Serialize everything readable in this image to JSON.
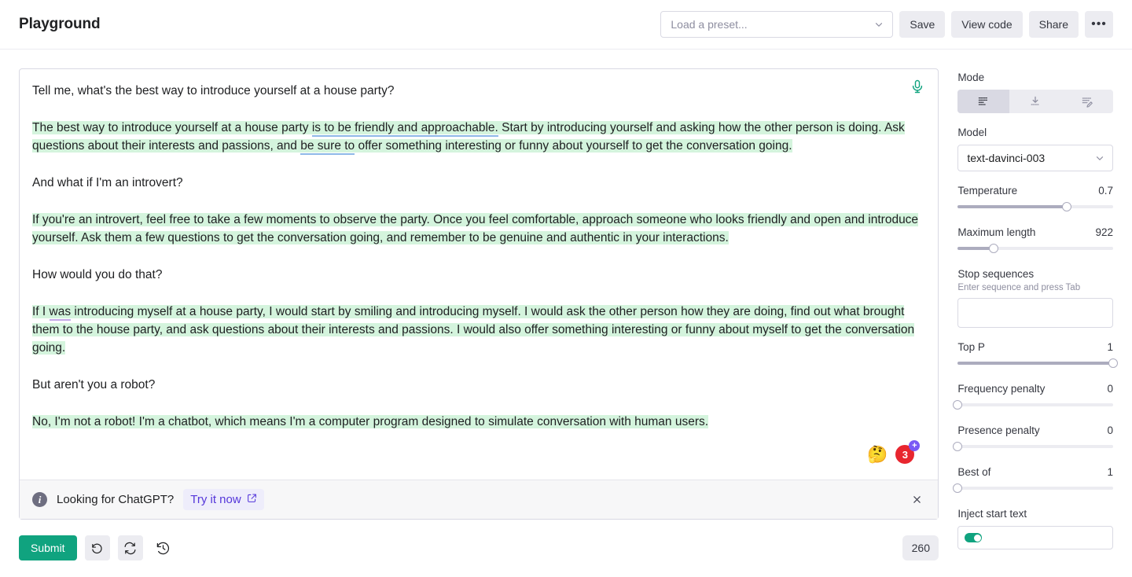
{
  "header": {
    "title": "Playground",
    "preset_placeholder": "Load a preset...",
    "save_label": "Save",
    "view_code_label": "View code",
    "share_label": "Share",
    "more_label": "•••"
  },
  "editor": {
    "mic_icon": "microphone-icon",
    "paragraphs": [
      {
        "kind": "prompt",
        "text": "Tell me, what's the best way to introduce yourself at a house party?"
      },
      {
        "kind": "completion",
        "segments": [
          {
            "text": "The best way to introduce yourself at a house party ",
            "underline": "none"
          },
          {
            "text": "is to be friendly and approachable.",
            "underline": "blue"
          },
          {
            "text": " Start by introducing yourself and asking how the other person is doing. Ask questions about their interests and passions, and ",
            "underline": "none"
          },
          {
            "text": "be sure to",
            "underline": "blue"
          },
          {
            "text": " offer something interesting or funny about yourself to get the conversation going.",
            "underline": "none"
          }
        ]
      },
      {
        "kind": "prompt",
        "text": "And what if I'm an introvert?"
      },
      {
        "kind": "completion",
        "segments": [
          {
            "text": "If you're an introvert, feel free to take a few moments to observe the party. Once you feel comfortable, approach someone who looks friendly and open and introduce yourself. Ask them a few questions to get the conversation going, and remember to be genuine and authentic in your interactions.",
            "underline": "none"
          }
        ]
      },
      {
        "kind": "prompt",
        "text": "How would you do that?"
      },
      {
        "kind": "completion",
        "segments": [
          {
            "text": "If I ",
            "underline": "none"
          },
          {
            "text": "was",
            "underline": "purple"
          },
          {
            "text": " introducing myself at a house party, I would start by smiling and introducing myself. I would ask the other person how they are doing, find out what brought them to the house party, and ask questions about their interests and passions. I would also offer something interesting or funny about myself to get the conversation going.",
            "underline": "none"
          }
        ]
      },
      {
        "kind": "prompt",
        "text": "But aren't you a robot?"
      },
      {
        "kind": "completion",
        "segments": [
          {
            "text": "No, I'm not a robot! I'm a chatbot, which means I'm a computer program designed to simulate conversation with human users.",
            "underline": "none"
          }
        ]
      }
    ],
    "badges": {
      "emoji": "🤔",
      "emoji_name": "thinking-face-emoji",
      "count": "3",
      "plus": "+"
    }
  },
  "banner": {
    "info_icon": "info-icon",
    "text": "Looking for ChatGPT?",
    "link_label": "Try it now",
    "external_icon": "external-link-icon",
    "close_icon": "close-icon"
  },
  "bottom": {
    "submit_label": "Submit",
    "undo_icon": "undo-icon",
    "regenerate_icon": "regenerate-icon",
    "history_icon": "history-icon",
    "token_count": "260"
  },
  "sidebar": {
    "mode": {
      "label": "Mode",
      "options": [
        {
          "name": "complete-mode",
          "icon": "lines-icon",
          "active": true
        },
        {
          "name": "insert-mode",
          "icon": "download-icon",
          "active": false
        },
        {
          "name": "edit-mode",
          "icon": "edit-lines-icon",
          "active": false
        }
      ]
    },
    "model": {
      "label": "Model",
      "value": "text-davinci-003"
    },
    "sliders": [
      {
        "name": "temperature",
        "label": "Temperature",
        "value": "0.7",
        "percent": 70
      },
      {
        "name": "maximum-length",
        "label": "Maximum length",
        "value": "922",
        "percent": 23
      }
    ],
    "stop_sequences": {
      "label": "Stop sequences",
      "hint": "Enter sequence and press Tab",
      "value": ""
    },
    "sliders2": [
      {
        "name": "top-p",
        "label": "Top P",
        "value": "1",
        "percent": 100
      },
      {
        "name": "frequency-penalty",
        "label": "Frequency penalty",
        "value": "0",
        "percent": 0
      },
      {
        "name": "presence-penalty",
        "label": "Presence penalty",
        "value": "0",
        "percent": 0
      },
      {
        "name": "best-of",
        "label": "Best of",
        "value": "1",
        "percent": 0
      }
    ],
    "inject_start_text": {
      "label": "Inject start text"
    }
  },
  "colors": {
    "accent_green": "#10a37f",
    "highlight_green": "#d4f4dd",
    "link_purple": "#5436da",
    "badge_red": "#e8262f",
    "badge_purple": "#7a5af5"
  }
}
